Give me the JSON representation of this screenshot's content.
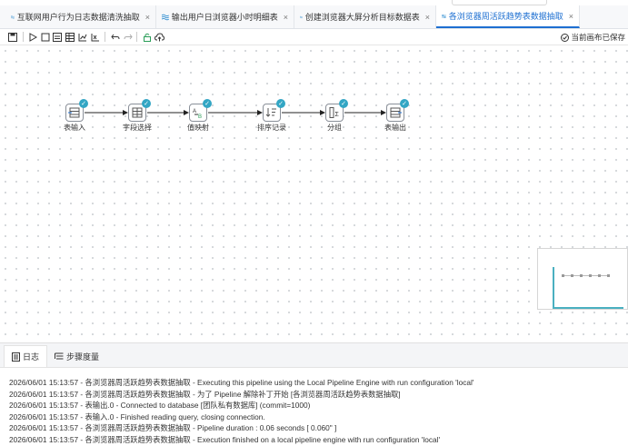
{
  "tabs": [
    {
      "label": "互联网用户行为日志数据清洗抽取",
      "active": false
    },
    {
      "label": "输出用户日浏览器小时明细表",
      "active": false
    },
    {
      "label": "创建浏览器大屏分析目标数据表",
      "active": false
    },
    {
      "label": "各浏览器周活跃趋势表数据抽取",
      "active": true
    }
  ],
  "tab_close_glyph": "×",
  "toolbar": {
    "icons": [
      "save-icon",
      "run-icon",
      "stop-icon",
      "preview-icon",
      "debug-icon",
      "impact-icon",
      "sql-icon",
      "undo-icon",
      "redo-icon",
      "lock-icon",
      "publish-icon"
    ],
    "saved_text": "当前画布已保存"
  },
  "pipeline": {
    "nodes": [
      {
        "label": "表输入",
        "icon": "table-input-icon"
      },
      {
        "label": "字段选择",
        "icon": "field-select-icon"
      },
      {
        "label": "值映射",
        "icon": "value-mapping-icon"
      },
      {
        "label": "排序记录",
        "icon": "sort-icon"
      },
      {
        "label": "分组",
        "icon": "group-by-icon"
      },
      {
        "label": "表输出",
        "icon": "table-output-icon"
      }
    ],
    "status_icon": "check-icon"
  },
  "colors": {
    "accent": "#1d6fd1",
    "node_check": "#33a6c4",
    "minimap_frame": "#4ab0c0"
  },
  "log_tabs": [
    {
      "label": "日志",
      "icon": "log-icon",
      "active": true
    },
    {
      "label": "步骤度量",
      "icon": "metrics-icon",
      "active": false
    }
  ],
  "log_lines": [
    "2026/06/01 15:13:57 - 各浏览器周活跃趋势表数据抽取 - Executing this pipeline using the Local Pipeline Engine with run configuration 'local'",
    "2026/06/01 15:13:57 - 各浏览器周活跃趋势表数据抽取 - 为了 Pipeline 解除补丁开始 [各浏览器周活跃趋势表数据抽取]",
    "2026/06/01 15:13:57 - 表输出.0 - Connected to database [团队私有数据库] (commit=1000)",
    "2026/06/01 15:13:57 - 表输入.0 - Finished reading query, closing connection.",
    "2026/06/01 15:13:57 - 各浏览器周活跃趋势表数据抽取 - Pipeline duration : 0.06 seconds [  0.060\" ]",
    "2026/06/01 15:13:57 - 各浏览器周活跃趋势表数据抽取 - Execution finished on a local pipeline engine with run configuration 'local'"
  ]
}
